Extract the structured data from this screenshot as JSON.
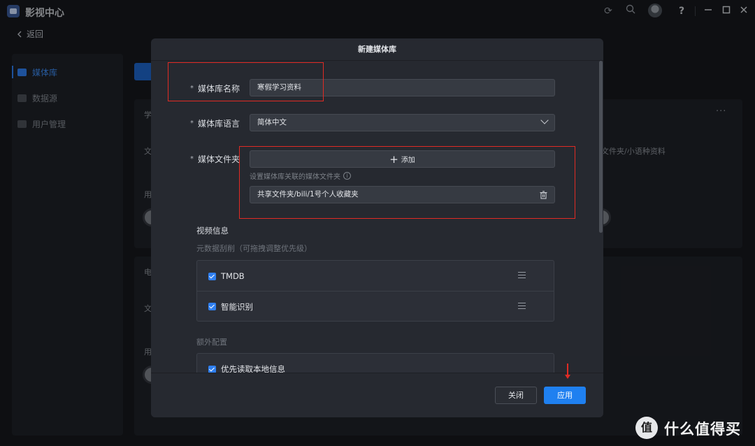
{
  "app": {
    "title": "影视中心",
    "back_label": "返回",
    "help_label": "?"
  },
  "sidebar": {
    "items": [
      {
        "label": "媒体库",
        "active": true
      },
      {
        "label": "数据源",
        "active": false
      },
      {
        "label": "用户管理",
        "active": false
      }
    ]
  },
  "background": {
    "card1_title": "学",
    "card1_line": "文",
    "card1_use": "用",
    "card1_right_text": "文件夹/小语种资料",
    "card2_title": "电",
    "card2_line": "文",
    "card2_use": "用"
  },
  "modal": {
    "title": "新建媒体库",
    "name_label": "媒体库名称",
    "name_value": "寒假学习资料",
    "language_label": "媒体库语言",
    "language_value": "简体中文",
    "folder_label": "媒体文件夹",
    "add_label": "添加",
    "folder_hint": "设置媒体库关联的媒体文件夹",
    "folder_path": "共享文件夹/bili/1号个人收藏夹",
    "required_mark": "*",
    "video_info_title": "视频信息",
    "scrape_subtitle": "元数据刮削（可拖拽调整优先级）",
    "scrapers": [
      {
        "label": "TMDB",
        "checked": true
      },
      {
        "label": "智能识别",
        "checked": true
      }
    ],
    "extra_title": "额外配置",
    "extra_options": [
      {
        "label": "优先读取本地信息",
        "checked": true
      }
    ],
    "close_label": "关闭",
    "apply_label": "应用"
  },
  "watermark": {
    "badge": "值",
    "text": "什么值得买"
  },
  "colors": {
    "accent": "#1f80f0",
    "annotation": "#e02b24"
  }
}
